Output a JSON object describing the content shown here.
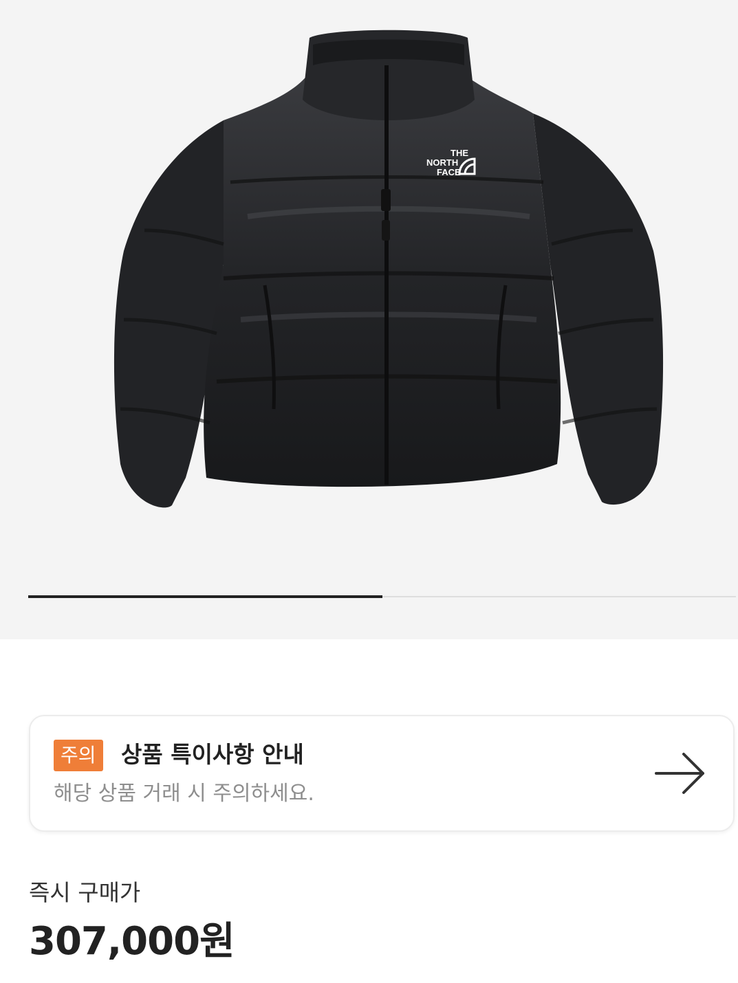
{
  "product": {
    "brand_logo_lines": [
      "THE",
      "NORTH",
      "FACE"
    ],
    "image_count_progress": 0.5
  },
  "notice": {
    "badge": "주의",
    "title": "상품 특이사항 안내",
    "description": "해당 상품 거래 시 주의하세요.",
    "arrow_icon": "arrow-right-icon"
  },
  "price": {
    "label": "즉시 구매가",
    "value": "307,000원"
  },
  "colors": {
    "badge": "#ef7e38",
    "gallery_bg": "#f4f4f4",
    "text_primary": "#222222",
    "text_secondary": "#8e8e8e"
  }
}
